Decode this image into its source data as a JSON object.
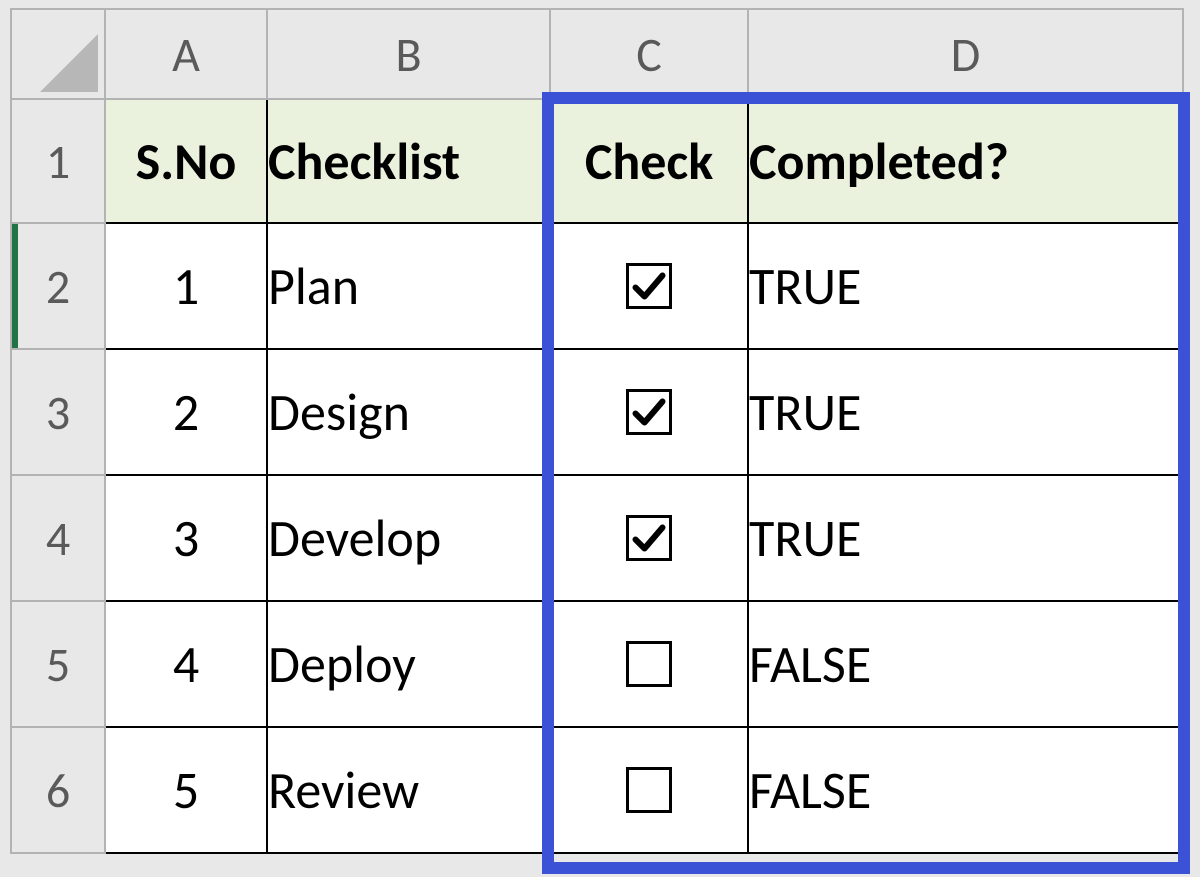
{
  "columns": {
    "A": "A",
    "B": "B",
    "C": "C",
    "D": "D"
  },
  "row_numbers": {
    "r1": "1",
    "r2": "2",
    "r3": "3",
    "r4": "4",
    "r5": "5",
    "r6": "6"
  },
  "headers": {
    "sno": "S.No",
    "checklist": "Checklist",
    "check": "Check",
    "completed": "Completed?"
  },
  "rows": [
    {
      "sno": "1",
      "checklist": "Plan",
      "checked": true,
      "completed": "TRUE"
    },
    {
      "sno": "2",
      "checklist": "Design",
      "checked": true,
      "completed": "TRUE"
    },
    {
      "sno": "3",
      "checklist": "Develop",
      "checked": true,
      "completed": "TRUE"
    },
    {
      "sno": "4",
      "checklist": "Deploy",
      "checked": false,
      "completed": "FALSE"
    },
    {
      "sno": "5",
      "checklist": "Review",
      "checked": false,
      "completed": "FALSE"
    }
  ],
  "highlight_color": "#3b52d6",
  "header_fill": "#eaf1dd"
}
